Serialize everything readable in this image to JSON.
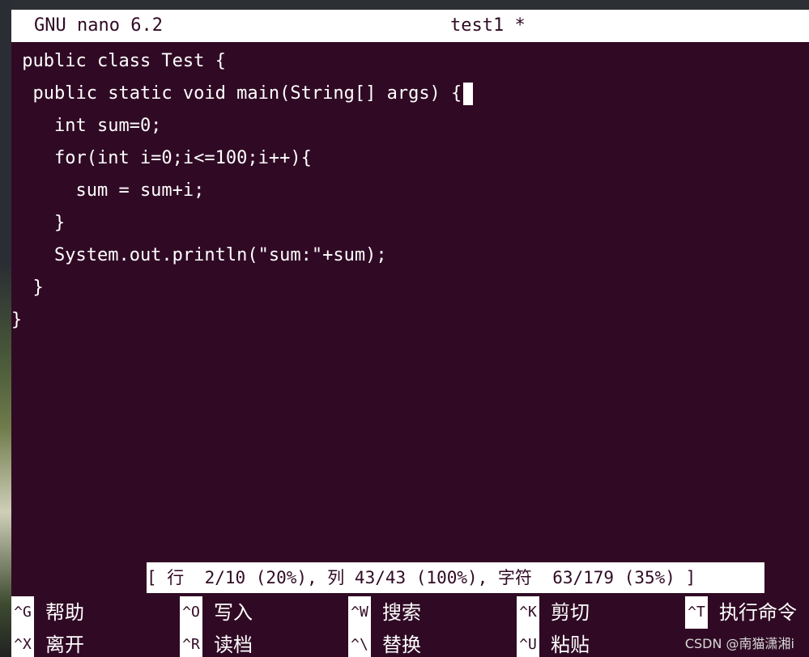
{
  "window": {
    "app_version": "GNU nano 6.2",
    "filename": "test1 *"
  },
  "editor": {
    "lines": [
      " public class Test {",
      "  public static void main(String[] args) {",
      "    int sum=0;",
      "    for(int i=0;i<=100;i++){",
      "      sum = sum+i;",
      "    }",
      "    System.out.println(\"sum:\"+sum);",
      "  }",
      "}"
    ]
  },
  "status": {
    "text": "[ 行  2/10 (20%), 列 43/43 (100%), 字符  63/179 (35%) ]"
  },
  "shortcuts": {
    "row1": [
      {
        "key": "^G",
        "label": "帮助"
      },
      {
        "key": "^O",
        "label": "写入"
      },
      {
        "key": "^W",
        "label": "搜索"
      },
      {
        "key": "^K",
        "label": "剪切"
      },
      {
        "key": "^T",
        "label": "执行命令"
      }
    ],
    "row2": [
      {
        "key": "^X",
        "label": "离开"
      },
      {
        "key": "^R",
        "label": "读档"
      },
      {
        "key": "^\\",
        "label": "替换"
      },
      {
        "key": "^U",
        "label": "粘贴"
      },
      {
        "key": "",
        "label": ""
      }
    ]
  },
  "watermark": "CSDN @南猫潇湘i",
  "colors": {
    "terminal_bg": "#300a24",
    "inverse_bg": "#ffffff"
  }
}
